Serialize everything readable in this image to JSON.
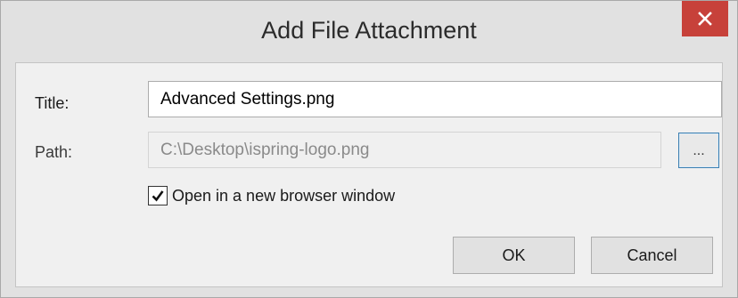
{
  "dialog": {
    "title": "Add File Attachment",
    "close_icon": "close-icon"
  },
  "form": {
    "title_label": "Title:",
    "title_value": "Advanced Settings.png",
    "path_label": "Path:",
    "path_value": "C:\\Desktop\\ispring-logo.png",
    "path_enabled": false,
    "browse_label": "...",
    "open_new_window_label": "Open in a new browser window",
    "open_new_window_checked": true
  },
  "buttons": {
    "ok_label": "OK",
    "cancel_label": "Cancel"
  },
  "colors": {
    "close_button": "#c7413a",
    "focus_border": "#3c7fb1"
  }
}
